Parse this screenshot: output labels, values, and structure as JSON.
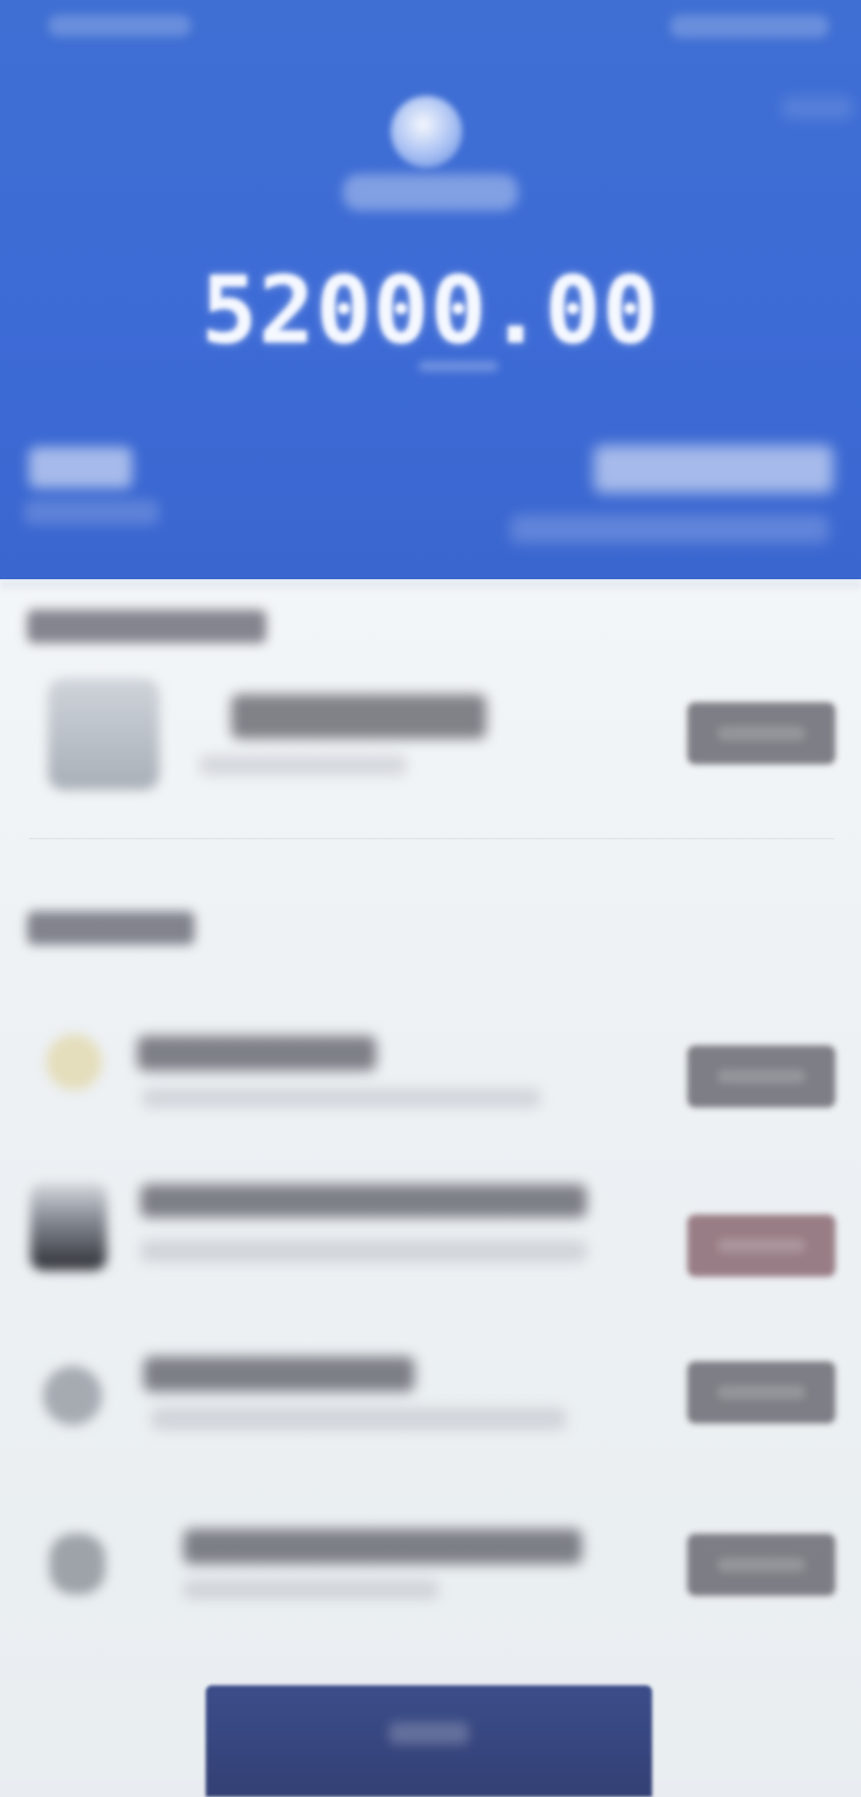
{
  "wallet": {
    "balance": "52000.00"
  },
  "sections": {
    "first_title": "",
    "second_title": ""
  },
  "rows": [
    {
      "id": "profile",
      "title": "",
      "subtitle": "",
      "button_label": ""
    },
    {
      "id": "item-1",
      "title": "",
      "subtitle": "",
      "button_label": ""
    },
    {
      "id": "item-2",
      "title": "",
      "subtitle": "",
      "button_label": ""
    },
    {
      "id": "item-3",
      "title": "",
      "subtitle": "",
      "button_label": ""
    },
    {
      "id": "item-4",
      "title": "",
      "subtitle": "",
      "button_label": ""
    }
  ],
  "bottom_action": {
    "label": ""
  },
  "colors": {
    "header_blue": "#3d6bd6",
    "sheet_background": "#edf1f4",
    "button_gray": "#6b6b73",
    "button_muted_red": "#8b6a73",
    "bottom_button_navy": "#334075"
  }
}
